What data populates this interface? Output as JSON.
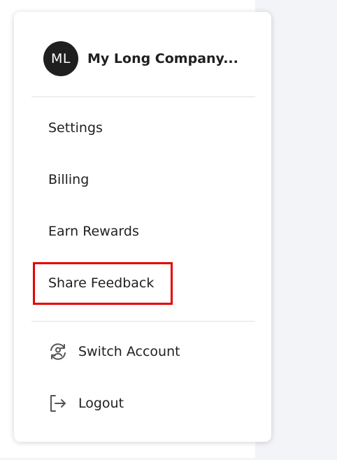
{
  "account": {
    "avatar_initials": "ML",
    "company_name": "My Long Company..."
  },
  "menu": {
    "items": [
      {
        "label": "Settings"
      },
      {
        "label": "Billing"
      },
      {
        "label": "Earn Rewards"
      },
      {
        "label": "Share Feedback"
      }
    ],
    "switch_account_label": "Switch Account",
    "switch_account_icon": "switch-account-icon",
    "logout_label": "Logout",
    "logout_icon": "logout-icon"
  },
  "colors": {
    "highlight": "#e60000",
    "text": "#1f1f1f",
    "avatar_bg": "#1f1f1f",
    "side_background": "#f3f4f7"
  }
}
